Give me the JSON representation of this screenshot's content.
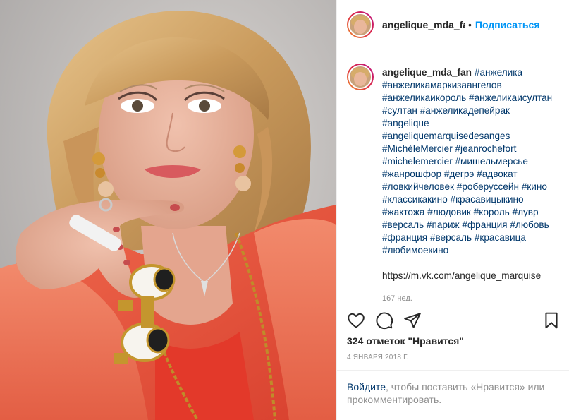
{
  "header": {
    "username": "angelique_mda_fan",
    "separator": "•",
    "follow_label": "Подписаться"
  },
  "caption": {
    "username": "angelique_mda_fan",
    "hashtags": [
      "#анжелика",
      "#анжеликамаркизаангелов",
      "#анжеликаикороль",
      "#анжеликаисултан",
      "#султан",
      "#анжеликадепейрак",
      "#angelique",
      "#angeliquemarquisedesanges",
      "#MichèleMercier",
      "#jeanrochefort",
      "#michelemercier",
      "#мишельмерсье",
      "#жанрошфор",
      "#дегрэ",
      "#адвокат",
      "#ловкийчеловек",
      "#роберуссейн",
      "#кино",
      "#классикакино",
      "#красавицыкино",
      "#жактожа",
      "#людовик",
      "#король",
      "#лувр",
      "#версаль",
      "#париж",
      "#франция",
      "#любовь",
      "#франция",
      "#версаль",
      "#красавица",
      "#любимоекино"
    ],
    "link": "https://m.vk.com/angelique_marquise",
    "age": "167 нед."
  },
  "actions": {
    "like_icon": "heart-icon",
    "comment_icon": "comment-icon",
    "share_icon": "paper-plane-icon",
    "save_icon": "bookmark-icon"
  },
  "likes_text": "324 отметок \"Нравится\"",
  "date_text": "4 января 2018 г.",
  "login": {
    "link_label": "Войдите",
    "rest": ", чтобы поставить «Нравится» или прокомментировать."
  },
  "colors": {
    "accent": "#0095f6",
    "hashtag": "#00376b",
    "muted": "#8e8e8e",
    "text": "#262626"
  }
}
